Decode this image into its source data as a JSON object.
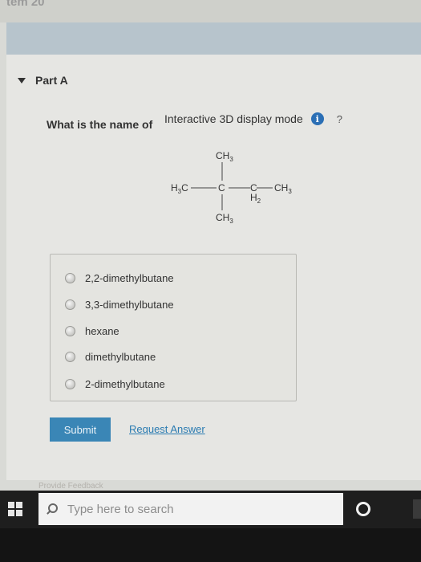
{
  "header": {
    "item_title": "tem 20"
  },
  "part": {
    "label": "Part A"
  },
  "question": {
    "text": "What is the name of"
  },
  "display_mode": {
    "label": "Interactive 3D display mode",
    "info_glyph": "i",
    "help_glyph": "?"
  },
  "molecule": {
    "top": "CH",
    "top_sub": "3",
    "left": "H",
    "left_sub": "3",
    "left_tail": "C",
    "center_c": "C",
    "right_c": "C",
    "right_h": "H",
    "right_h_sub": "2",
    "right": "CH",
    "right_sub": "3",
    "bottom": "CH",
    "bottom_sub": "3"
  },
  "answers": {
    "options": [
      "2,2-dimethylbutane",
      "3,3-dimethylbutane",
      "hexane",
      "dimethylbutane",
      "2-dimethylbutane"
    ]
  },
  "actions": {
    "submit_label": "Submit",
    "request_label": "Request Answer"
  },
  "footer": {
    "faded_text": "Provide Feedback"
  },
  "taskbar": {
    "search_placeholder": "Type here to search"
  },
  "colors": {
    "accent": "#3a86b6",
    "link": "#2a7bb1",
    "taskbar": "#141414"
  }
}
